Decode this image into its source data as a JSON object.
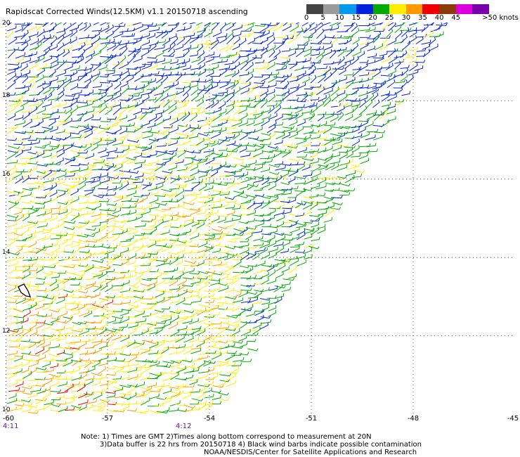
{
  "title": "Rapidscat Corrected Winds(12.5KM) v1.1 20150718 ascending",
  "colorbar": {
    "colors": [
      "#444444",
      "#9a9a9a",
      "#0099ee",
      "#0022dd",
      "#00aa00",
      "#ffee00",
      "#ff9900",
      "#ee0000",
      "#8b3a0a",
      "#dd00dd",
      "#7700aa"
    ],
    "labels": [
      "0",
      "5",
      "10",
      "15",
      "20",
      "25",
      "30",
      "35",
      "40",
      "45",
      ">50 knots"
    ]
  },
  "map": {
    "lon_range": [
      -60,
      -45
    ],
    "lat_range": [
      10,
      20
    ],
    "x_ticks": [
      "-60",
      "-57",
      "-54",
      "-51",
      "-48",
      "-45"
    ],
    "y_ticks": [
      "20",
      "18",
      "16",
      "14",
      "12",
      "10"
    ],
    "island_shown": true
  },
  "times": {
    "left": "4:11",
    "center": "4:12"
  },
  "notes": {
    "line1": "Note: 1) Times are GMT 2)Times along bottom correspond to measurement at 20N",
    "line2": "3)Data buffer is 22 hrs from 20150718 4) Black wind barbs indicate possible contamination",
    "line3": "NOAA/NESDIS/Center for Satellite Applications and Research"
  }
}
